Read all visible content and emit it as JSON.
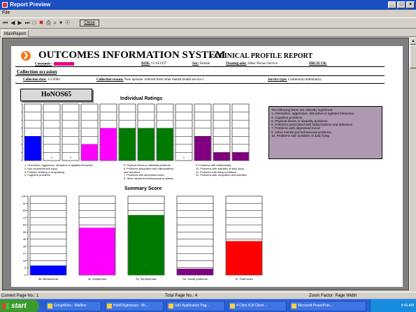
{
  "window": {
    "title": "Report Preview",
    "btn_min": "_",
    "btn_max": "□",
    "btn_close": "×"
  },
  "menu": {
    "file": "File"
  },
  "toolbar": {
    "close_label": "Close"
  },
  "tabs": {
    "main": "MainReport"
  },
  "report": {
    "title": "OUTCOMES INFORMATION SYSTEM",
    "subtitle": "- CLINICAL PROFILE REPORT",
    "consumer_label": "Consumer:",
    "dob_label": "DOB:",
    "dob": "11/10/1937",
    "sex_label": "Sex:",
    "sex": "Female",
    "unit_label": "Treating unit:",
    "unit": "28dec Person Service",
    "hbcis_label": "HBCIS UR:",
    "section": "Collection occasion",
    "coll_date_label": "Collection date:",
    "coll_date": "3/3/2004",
    "coll_reason_label": "Collection reason:",
    "coll_reason": "New episode: referred from other mental health service t",
    "setting_label": "Service type:",
    "setting": "Community/ambulatory",
    "instrument": "HoNOS65"
  },
  "legend": {
    "title": "The following items are clinically significant",
    "items": [
      "1. Overactive, aggressive, disruptive or agitated behaviour",
      "4. Cognitive problems",
      "5. Physical illness or disability problems",
      "6. Problems associated with hallucinations and delusions",
      "7. Problems with depressed mood",
      "8. Other mental and behavioural problems",
      "10. Problems with activities of daily living"
    ]
  },
  "item_legend": {
    "col1": [
      "1. Overactive, aggressive, disruptive or agitated behaviour",
      "2. Non-accidental self-injury",
      "3. Problem drinking or drug-taking",
      "4. Cognitive problems"
    ],
    "col2": [
      "5. Physical illness or disability problems",
      "6. Problems associated with hallucinations",
      "and delusions",
      "7. Problems with depressed mood",
      "8. Other mental and behavioural problems"
    ],
    "col3": [
      "9. Problems with relationships",
      "10. Problems with activities of daily living",
      "11. Problems with living conditions",
      "12. Problems with occupation and activities"
    ]
  },
  "chart_data": [
    {
      "type": "bar",
      "title": "Individual Ratings",
      "categories": [
        "1",
        "2",
        "3",
        "4",
        "5",
        "6",
        "7",
        "8",
        "9",
        "10",
        "11",
        "12"
      ],
      "values": [
        3,
        0,
        0,
        2,
        4,
        4,
        4,
        4,
        0,
        3,
        1,
        1
      ],
      "ylim": [
        0,
        7
      ],
      "colors": [
        "#0000ff",
        "#ffffff",
        "#ffffff",
        "#ff00ff",
        "#ff00ff",
        "#007a00",
        "#007a00",
        "#007a00",
        "#ffffff",
        "#800080",
        "#800080",
        "#800080"
      ],
      "data_labels": [
        "3",
        "0",
        "0",
        "2",
        "4",
        "4",
        "4",
        "4",
        "0",
        "3",
        "1",
        "1"
      ]
    },
    {
      "type": "bar",
      "title": "Summary Score",
      "categories": [
        "8a. Behavioural",
        "Im. Impairment",
        "Sy. Symptomatic",
        "So. Social problems",
        "To. Total score"
      ],
      "values": [
        12,
        60,
        76,
        8,
        43
      ],
      "ylim": [
        0,
        100
      ],
      "yticks": [
        "100",
        "91",
        "82",
        "73",
        "64",
        "55",
        "45",
        "36",
        "27",
        "18",
        "9",
        "0"
      ],
      "colors": [
        "#0000ff",
        "#ff00ff",
        "#007a00",
        "#800080",
        "#ff0000"
      ],
      "data_labels": [
        "12",
        "60",
        "76",
        "8",
        "43"
      ]
    }
  ],
  "status": {
    "page": "Current Page No.: 1",
    "total": "Total Page No.: 4",
    "zoom": "Zoom Factor: Page Width"
  },
  "taskbar": {
    "start": "start",
    "items": [
      "GroupWise - Mailbox",
      "HoNOSglossary - Mi...",
      "UAT Application Pag...",
      "4 Citrix ICA Client ...",
      "Microsoft PowerPoin..."
    ],
    "clock": "9:46 AM"
  }
}
